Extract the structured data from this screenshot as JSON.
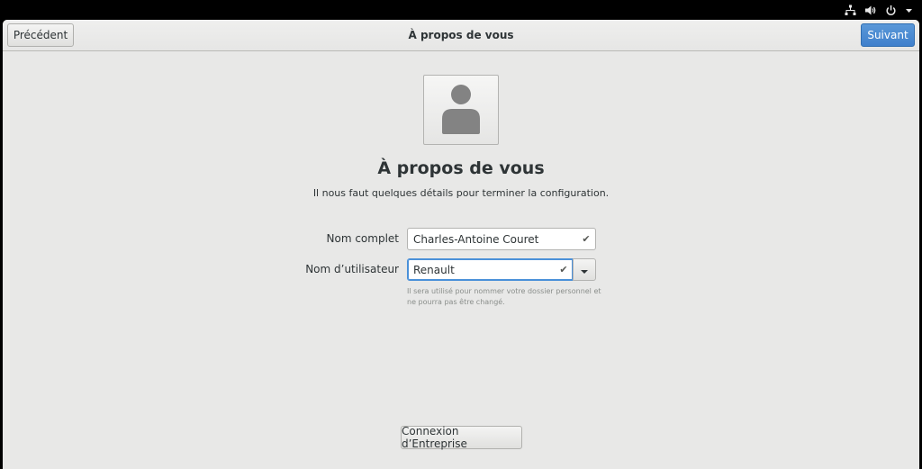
{
  "status_bar": {
    "icons": [
      "network-wired-icon",
      "volume-icon",
      "power-icon",
      "chevron-down-icon"
    ]
  },
  "header": {
    "title": "À propos de vous",
    "back_label": "Précédent",
    "next_label": "Suivant"
  },
  "main": {
    "avatar_icon": "user-avatar-icon",
    "title": "À propos de vous",
    "subtitle": "Il nous faut quelques détails pour terminer la configuration.",
    "form": {
      "fullname_label": "Nom complet",
      "fullname_value": "Charles-Antoine Couret",
      "username_label": "Nom d’utilisateur",
      "username_value": "Renault",
      "hint": "Il sera utilisé pour nommer votre dossier personnel et ne pourra pas être changé."
    },
    "enterprise_button_label": "Connexion d’Entreprise"
  },
  "colors": {
    "accent": "#4a90d9",
    "background": "#e8e8e7",
    "topbar": "#000000"
  }
}
